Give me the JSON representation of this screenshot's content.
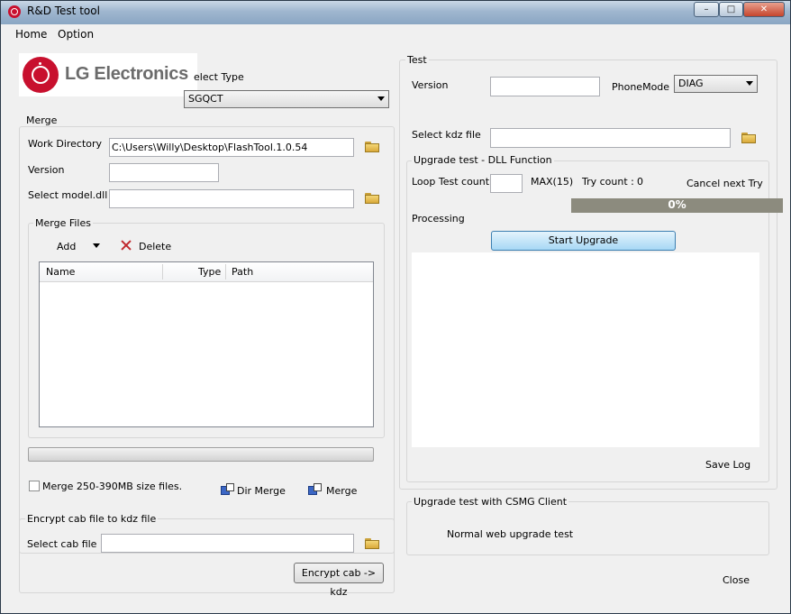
{
  "window": {
    "title": "R&D Test tool"
  },
  "menu": {
    "items": [
      "Home",
      "Option"
    ]
  },
  "logo": {
    "text": "LG Electronics"
  },
  "select_type": {
    "label": "elect Type",
    "value": "SGQCT"
  },
  "merge": {
    "group_label": "Merge",
    "work_dir_label": "Work Directory",
    "work_dir_value": "C:\\Users\\Willy\\Desktop\\FlashTool.1.0.54",
    "version_label": "Version",
    "version_value": "",
    "model_dll_label": "Select model.dll",
    "model_dll_value": "",
    "files": {
      "group_label": "Merge Files",
      "add_label": "Add",
      "delete_label": "Delete",
      "columns": [
        "Name",
        "Type",
        "Path"
      ]
    },
    "progress": 0,
    "checkbox_label": "Merge 250-390MB size files.",
    "checkbox_checked": false,
    "dir_merge_label": "Dir Merge",
    "merge_label": "Merge"
  },
  "encrypt": {
    "group_label": "Encrypt cab file to kdz file",
    "cab_label": "Select cab file",
    "cab_value": "",
    "button_label": "Encrypt cab -> kdz"
  },
  "test": {
    "group_label": "Test",
    "version_label": "Version",
    "version_value": "",
    "phonemode_label": "PhoneMode",
    "phonemode_value": "DIAG",
    "kdz_label": "Select kdz file",
    "kdz_value": ""
  },
  "upgrade_dll": {
    "group_label": "Upgrade test - DLL Function",
    "loop_label": "Loop Test count",
    "loop_value": "",
    "max_label": "MAX(15)",
    "try_count_label": "Try count :",
    "try_count_value": "0",
    "cancel_label": "Cancel next Try",
    "percent_text": "0%",
    "percent_value": 0,
    "processing_label": "Processing",
    "start_button": "Start Upgrade",
    "save_log": "Save Log"
  },
  "csmg": {
    "group_label": "Upgrade test with CSMG Client",
    "normal_web": "Normal web upgrade test"
  },
  "close_label": "Close",
  "colors": {
    "titlebar": "#9fb6cf",
    "lg_red": "#c8102e",
    "progress_track": "#8c8b7e",
    "start_button": "#a7d8f5"
  }
}
